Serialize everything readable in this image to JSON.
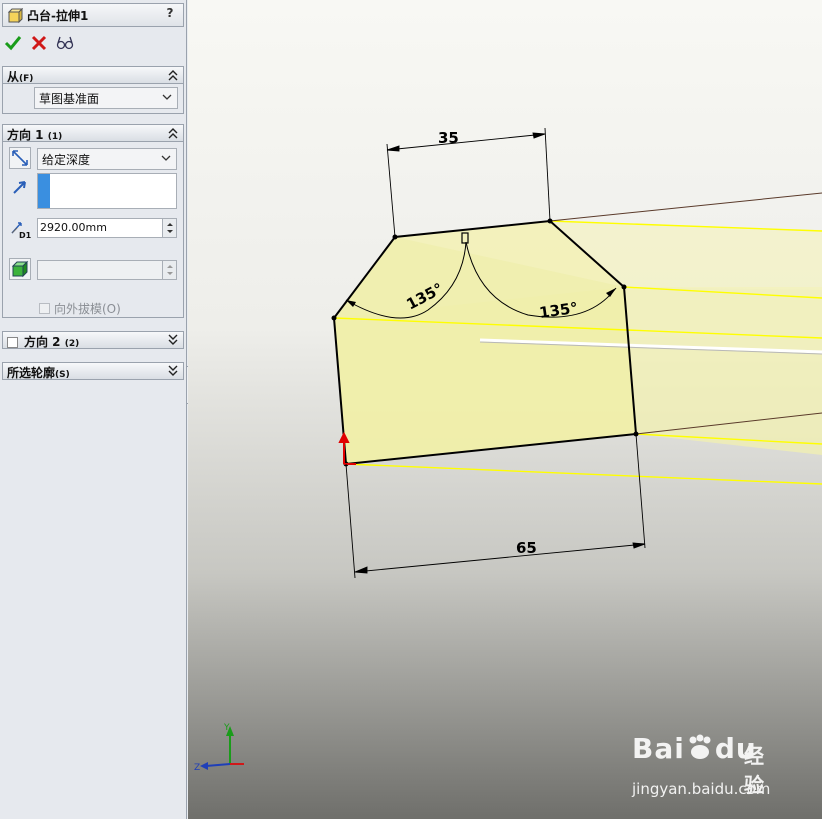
{
  "panel": {
    "title": "凸台-拉伸1",
    "help": "?",
    "from": {
      "header": "从",
      "shortcut": "(F)",
      "start_condition": "草图基准面"
    },
    "direction1": {
      "header": "方向 1",
      "shortcut": "(1)",
      "end_condition": "给定深度",
      "depth_label": "D1",
      "depth_value": "2920.00mm",
      "draft_outward_label": "向外拔模(O)"
    },
    "direction2": {
      "header": "方向 2",
      "shortcut": "(2)"
    },
    "selected_contours": {
      "header": "所选轮廓",
      "shortcut": "(S)"
    }
  },
  "viewport": {
    "dimensions": {
      "top_width": "35",
      "bottom_width": "65",
      "left_angle": "135°",
      "right_angle": "135°"
    },
    "triad": {
      "z_label": "Z",
      "y_label": "Y"
    }
  },
  "watermark": {
    "brand": "Bai",
    "brand2": "du",
    "product": "经验",
    "url": "jingyan.baidu.com"
  },
  "colors": {
    "accept": "#1a9c1a",
    "cancel": "#d01818",
    "face_fill": "#f0eeaa",
    "edge_highlight": "#ffff00"
  }
}
